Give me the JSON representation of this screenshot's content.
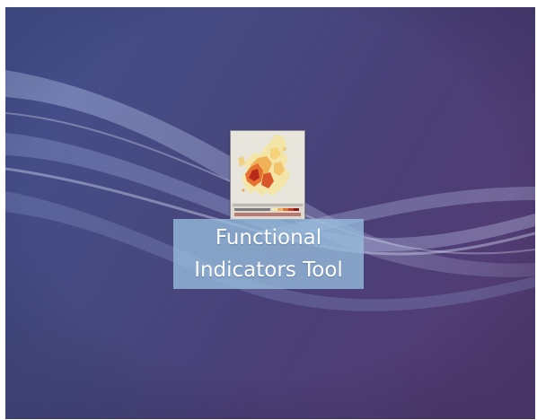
{
  "desktop": {
    "background_colors": [
      "#44508e",
      "#46497f",
      "#563b72"
    ],
    "icons": [
      {
        "label_line1": "Functional",
        "label_line2": "Indicators Tool",
        "icon_name": "map-thumbnail-icon",
        "selected": true,
        "label_highlight_color": "#96bedc"
      }
    ]
  }
}
